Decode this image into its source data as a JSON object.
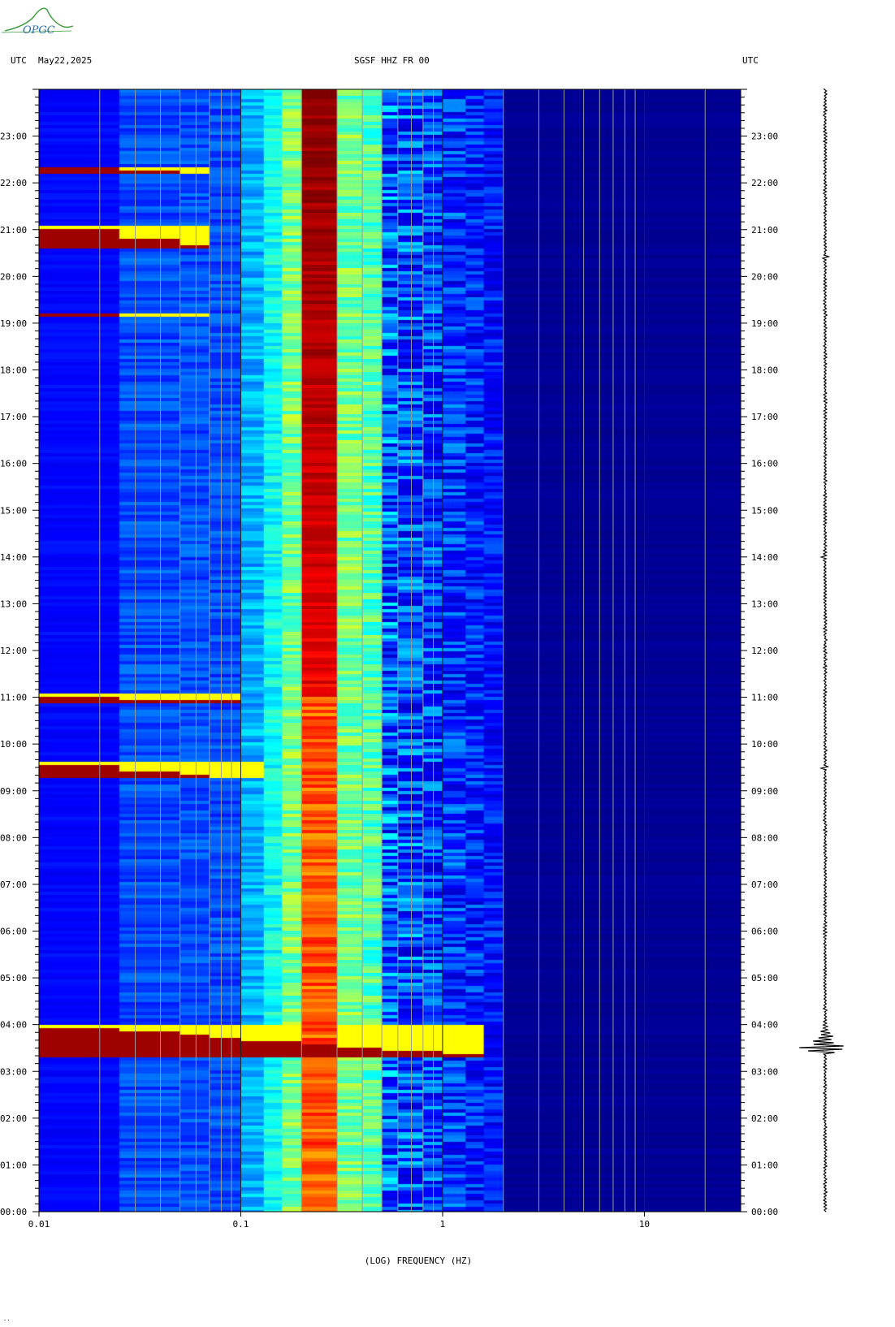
{
  "header": {
    "left_tz": "UTC",
    "date": "May22,2025",
    "station": "SGSF HHZ FR 00",
    "right_tz": "UTC"
  },
  "logo_text": "OPGC",
  "footnote": "..",
  "chart_data": {
    "type": "heatmap",
    "title": "SGSF HHZ FR 00",
    "xlabel": "(LOG) FREQUENCY (HZ)",
    "x_scale": "log",
    "xlim": [
      0.01,
      30
    ],
    "x_ticks": [
      {
        "value": 0.01,
        "label": "0.01"
      },
      {
        "value": 0.1,
        "label": "0.1"
      },
      {
        "value": 1,
        "label": "1"
      },
      {
        "value": 10,
        "label": "10"
      }
    ],
    "y_unit": "hours UTC",
    "ylim": [
      0,
      24
    ],
    "y_ticks": [
      {
        "value": 0,
        "label": "00:00"
      },
      {
        "value": 1,
        "label": "01:00"
      },
      {
        "value": 2,
        "label": "02:00"
      },
      {
        "value": 3,
        "label": "03:00"
      },
      {
        "value": 4,
        "label": "04:00"
      },
      {
        "value": 5,
        "label": "05:00"
      },
      {
        "value": 6,
        "label": "06:00"
      },
      {
        "value": 7,
        "label": "07:00"
      },
      {
        "value": 8,
        "label": "08:00"
      },
      {
        "value": 9,
        "label": "09:00"
      },
      {
        "value": 10,
        "label": "10:00"
      },
      {
        "value": 11,
        "label": "11:00"
      },
      {
        "value": 12,
        "label": "12:00"
      },
      {
        "value": 13,
        "label": "13:00"
      },
      {
        "value": 14,
        "label": "14:00"
      },
      {
        "value": 15,
        "label": "15:00"
      },
      {
        "value": 16,
        "label": "16:00"
      },
      {
        "value": 17,
        "label": "17:00"
      },
      {
        "value": 18,
        "label": "18:00"
      },
      {
        "value": 19,
        "label": "19:00"
      },
      {
        "value": 20,
        "label": "20:00"
      },
      {
        "value": 21,
        "label": "21:00"
      },
      {
        "value": 22,
        "label": "22:00"
      },
      {
        "value": 23,
        "label": "23:00"
      }
    ],
    "grid": true,
    "colormap": [
      "#00007f",
      "#0000ff",
      "#00ffff",
      "#ffff00",
      "#ff0000",
      "#7f0000"
    ],
    "microseism_band_hz": [
      0.15,
      0.5
    ],
    "microseism_peak_hz": [
      0.2,
      0.3
    ],
    "events": [
      {
        "start_hour": 3.33,
        "end_hour": 4.0,
        "max_freq_hz": 1.6,
        "note": "major earthquake"
      },
      {
        "start_hour": 9.25,
        "end_hour": 9.6,
        "max_freq_hz": 0.12
      },
      {
        "start_hour": 22.2,
        "end_hour": 22.35,
        "max_freq_hz": 0.08
      },
      {
        "start_hour": 20.6,
        "end_hour": 21.1,
        "max_freq_hz": 0.08
      },
      {
        "start_hour": 10.9,
        "end_hour": 11.05,
        "max_freq_hz": 0.1
      },
      {
        "start_hour": 19.15,
        "end_hour": 19.2,
        "max_freq_hz": 0.08
      }
    ],
    "waveform": {
      "event_hour": 3.45,
      "relative_peak": 1.0
    }
  }
}
